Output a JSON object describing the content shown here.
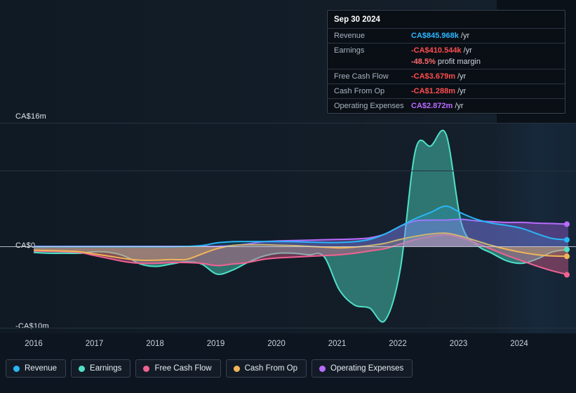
{
  "tooltip": {
    "title": "Sep 30 2024",
    "rows": [
      {
        "label": "Revenue",
        "value": "CA$845.968k",
        "unit": "/yr",
        "color": "#2eb6ff"
      },
      {
        "label": "Earnings",
        "value": "-CA$410.544k",
        "unit": "/yr",
        "color": "#ff4d4d",
        "sub": "-48.5%",
        "sub_note": "profit margin"
      },
      {
        "label": "Free Cash Flow",
        "value": "-CA$3.679m",
        "unit": "/yr",
        "color": "#ff4d4d"
      },
      {
        "label": "Cash From Op",
        "value": "-CA$1.288m",
        "unit": "/yr",
        "color": "#ff4d4d"
      },
      {
        "label": "Operating Expenses",
        "value": "CA$2.872m",
        "unit": "/yr",
        "color": "#b86bff"
      }
    ]
  },
  "axis": {
    "y_top": "CA$16m",
    "y_zero": "CA$0",
    "y_bottom": "-CA$10m",
    "x_ticks": [
      "2016",
      "2017",
      "2018",
      "2019",
      "2020",
      "2021",
      "2022",
      "2023",
      "2024"
    ]
  },
  "legend": [
    {
      "label": "Revenue",
      "color": "#29b6f6"
    },
    {
      "label": "Earnings",
      "color": "#4fe0c8"
    },
    {
      "label": "Free Cash Flow",
      "color": "#f06292"
    },
    {
      "label": "Cash From Op",
      "color": "#f0b55a"
    },
    {
      "label": "Operating Expenses",
      "color": "#b86bff"
    }
  ],
  "chart_data": {
    "type": "area",
    "title": "",
    "xlabel": "",
    "ylabel": "CA$",
    "ylim": [
      -10000000,
      16000000
    ],
    "y_ticks": [
      16000000,
      0,
      -10000000
    ],
    "y_tick_labels": [
      "CA$16m",
      "CA$0",
      "-CA$10m"
    ],
    "grid": true,
    "legend_position": "bottom",
    "x": [
      "2016.0",
      "2016.25",
      "2016.5",
      "2016.75",
      "2017.0",
      "2017.25",
      "2017.5",
      "2017.75",
      "2018.0",
      "2018.25",
      "2018.5",
      "2018.75",
      "2019.0",
      "2019.25",
      "2019.5",
      "2019.75",
      "2020.0",
      "2020.25",
      "2020.5",
      "2020.75",
      "2021.0",
      "2021.25",
      "2021.5",
      "2021.75",
      "2022.0",
      "2022.25",
      "2022.5",
      "2022.75",
      "2023.0",
      "2023.25",
      "2023.5",
      "2023.75",
      "2024.0",
      "2024.25",
      "2024.5",
      "2024.75"
    ],
    "x_tick_labels": [
      "2016",
      "2017",
      "2018",
      "2019",
      "2020",
      "2021",
      "2022",
      "2023",
      "2024"
    ],
    "series": [
      {
        "name": "Revenue",
        "color": "#29b6f6",
        "values": [
          -0.05,
          -0.05,
          -0.05,
          -0.05,
          -0.05,
          -0.05,
          -0.05,
          -0.05,
          -0.05,
          -0.05,
          0.0,
          0.1,
          0.45,
          0.6,
          0.62,
          0.62,
          0.62,
          0.6,
          0.55,
          0.5,
          0.5,
          0.6,
          0.9,
          1.6,
          2.6,
          3.6,
          4.4,
          5.2,
          4.3,
          3.5,
          3.0,
          2.7,
          2.3,
          1.6,
          1.0,
          0.85
        ]
      },
      {
        "name": "Earnings",
        "color": "#4fe0c8",
        "values": [
          -0.8,
          -0.9,
          -0.9,
          -0.9,
          -0.7,
          -0.8,
          -1.3,
          -2.3,
          -2.6,
          -2.3,
          -2.0,
          -2.3,
          -3.6,
          -3.1,
          -2.1,
          -1.3,
          -0.9,
          -0.9,
          -1.1,
          -1.3,
          -5.6,
          -7.6,
          -8.0,
          -9.6,
          -3.0,
          12.5,
          13.0,
          14.5,
          3.0,
          0.2,
          -0.9,
          -1.9,
          -2.2,
          -1.6,
          -0.7,
          -0.41
        ]
      },
      {
        "name": "Free Cash Flow",
        "color": "#f06292",
        "values": [
          -0.6,
          -0.65,
          -0.7,
          -0.8,
          -1.2,
          -1.6,
          -2.0,
          -2.2,
          -2.2,
          -2.1,
          -2.1,
          -2.2,
          -2.5,
          -2.3,
          -2.1,
          -1.7,
          -1.5,
          -1.4,
          -1.3,
          -1.2,
          -1.1,
          -0.9,
          -0.6,
          -0.3,
          0.3,
          0.9,
          1.3,
          1.5,
          1.1,
          0.4,
          -0.4,
          -1.2,
          -1.9,
          -2.6,
          -3.2,
          -3.68
        ]
      },
      {
        "name": "Cash From Op",
        "color": "#f0b55a",
        "values": [
          -0.5,
          -0.55,
          -0.6,
          -0.7,
          -1.0,
          -1.3,
          -1.6,
          -1.8,
          -1.8,
          -1.7,
          -1.7,
          -1.0,
          -0.3,
          0.1,
          0.2,
          0.2,
          0.15,
          0.1,
          0.0,
          -0.1,
          -0.2,
          -0.1,
          0.1,
          0.4,
          0.9,
          1.3,
          1.6,
          1.7,
          1.3,
          0.7,
          0.1,
          -0.4,
          -0.8,
          -1.1,
          -1.25,
          -1.29
        ]
      },
      {
        "name": "Operating Expenses",
        "color": "#b86bff",
        "values": [
          0.0,
          0.0,
          0.0,
          0.0,
          0.0,
          0.0,
          0.0,
          0.0,
          0.0,
          0.0,
          0.0,
          0.0,
          0.0,
          0.1,
          0.3,
          0.6,
          0.7,
          0.75,
          0.8,
          0.85,
          0.9,
          0.95,
          1.1,
          1.6,
          2.6,
          3.3,
          3.4,
          3.4,
          3.5,
          3.3,
          3.2,
          3.1,
          3.1,
          3.0,
          2.95,
          2.87
        ]
      }
    ]
  }
}
